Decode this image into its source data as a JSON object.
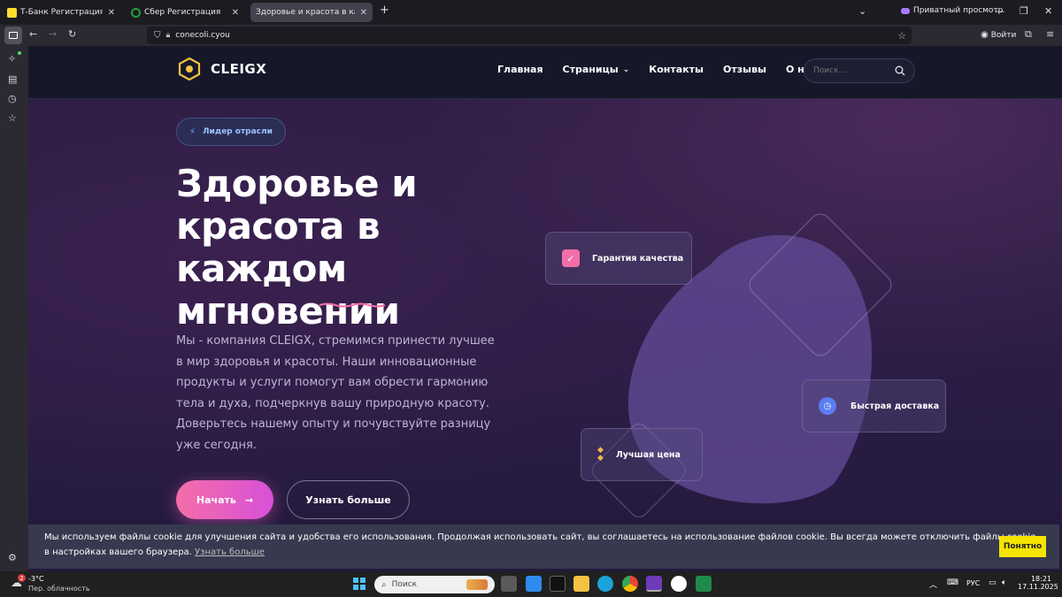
{
  "browser": {
    "tabs": [
      {
        "title": "Т-Банк Регистрация",
        "active": false
      },
      {
        "title": "Сбер Регистрация",
        "active": false
      },
      {
        "title": "Здоровье и красота в каждом мг",
        "active": true
      }
    ],
    "private_label": "Приватный просмотр",
    "url": "conecoli.cyou",
    "signin_label": "Войти"
  },
  "site": {
    "brand": "CLEIGX",
    "nav": [
      "Главная",
      "Страницы",
      "Контакты",
      "Отзывы",
      "О нас"
    ],
    "search_placeholder": "Поиск...",
    "badge": "Лидер отрасли",
    "title": "Здоровье и красота в каждом мгновении",
    "description": "Мы - компания CLEIGX, стремимся принести лучшее в мир здоровья и красоты. Наши инновационные продукты и услуги помогут вам обрести гармонию тела и духа, подчеркнув вашу природную красоту. Доверьтесь нашему опыту и почувствуйте разницу уже сегодня.",
    "btn_start": "Начать",
    "btn_more": "Узнать больше",
    "cards": {
      "quality": "Гарантия качества",
      "delivery": "Быстрая доставка",
      "price": "Лучшая цена"
    },
    "colors": {
      "accent": "#f46ea8",
      "accent2": "#d850d8",
      "cookie_btn": "#f4e400"
    }
  },
  "cookie": {
    "text": "Мы используем файлы cookie для улучшения сайта и удобства его использования. Продолжая использовать сайт, вы соглашаетесь на использование файлов cookie. Вы всегда можете отключить файлы cookie в настройках вашего браузера.",
    "link": "Узнать больше",
    "button": "Понятно"
  },
  "taskbar": {
    "weather_temp": "-3°C",
    "weather_desc": "Пер. облачность",
    "weather_badge": "2",
    "search_label": "Поиск",
    "lang": "РУС",
    "time": "18:21",
    "date": "17.11.2025"
  }
}
